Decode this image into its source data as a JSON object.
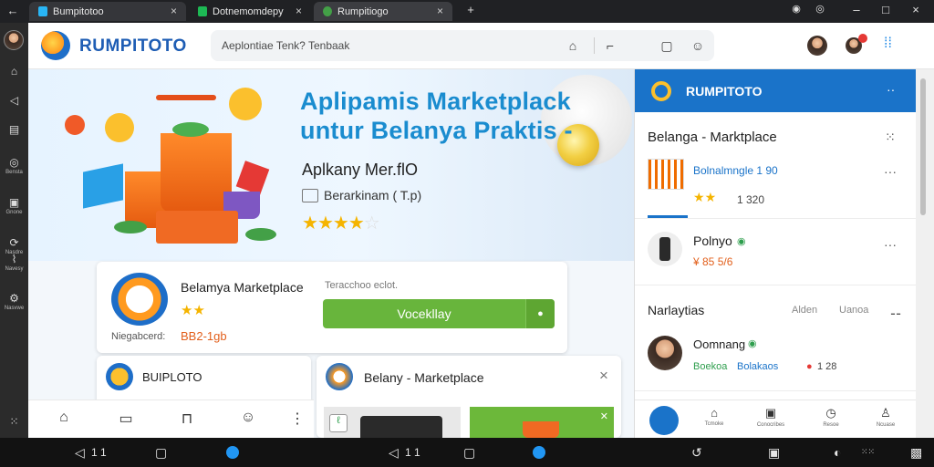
{
  "tabs": [
    {
      "title": "Bumpitotoo",
      "close": "×"
    },
    {
      "title": "Dotnemomdepy",
      "close": "×"
    },
    {
      "title": "Rumpitiogo",
      "close": "×"
    }
  ],
  "new_tab": "+",
  "window_controls": {
    "minimize": "–",
    "restore": "□",
    "close": "×"
  },
  "nav_back": "←",
  "rail": {
    "labels": [
      "Bensta",
      "Gnone",
      "Nasdre",
      "Navesy",
      "Nasvwe"
    ]
  },
  "header": {
    "brand": "RUMPITOTO",
    "search_text": "Aeplontiae Tenk? Tenbaak",
    "icon_colors": {
      "badge": "#e53935",
      "accent": "#1e88e5"
    }
  },
  "banner": {
    "headline_line1": "Aplipamis Marketplack",
    "headline_line2": "untur Belanya Praktis -",
    "subtitle": "Aplkany Mer.flO",
    "meta": "Berarkinam ( T.p)",
    "rating": 4
  },
  "card1": {
    "title": "Belamya Marketplace",
    "aside": "Teracchoo eclot.",
    "button": "Vocekllay",
    "label": "Niegabcerd:",
    "price": "BB2-1gb"
  },
  "card2": {
    "title": "BUIPLOTO"
  },
  "card3": {
    "title": "Belany - Marketplace",
    "close": "×"
  },
  "panel": {
    "brand": "RUMPITOTO",
    "section_title": "Belanga - Marktplace",
    "item1": {
      "title": "Bolnalmngle 1 90",
      "sub": "1 320"
    },
    "item2": {
      "title": "Polnyo",
      "sub": "¥ 85 5/6"
    },
    "section2_title": "Narlaytias",
    "section2_chips": [
      "Alden",
      "Uanoa"
    ],
    "item3": {
      "title": "Oomnang",
      "sub1": "Boekoa",
      "sub2": "Bolakaos",
      "sub3": "1 28"
    },
    "nav_labels": [
      "Tcmoke",
      "Conocribes",
      "Resoe",
      "Ncuase"
    ]
  },
  "system": {
    "nav_digits": "1 1"
  }
}
